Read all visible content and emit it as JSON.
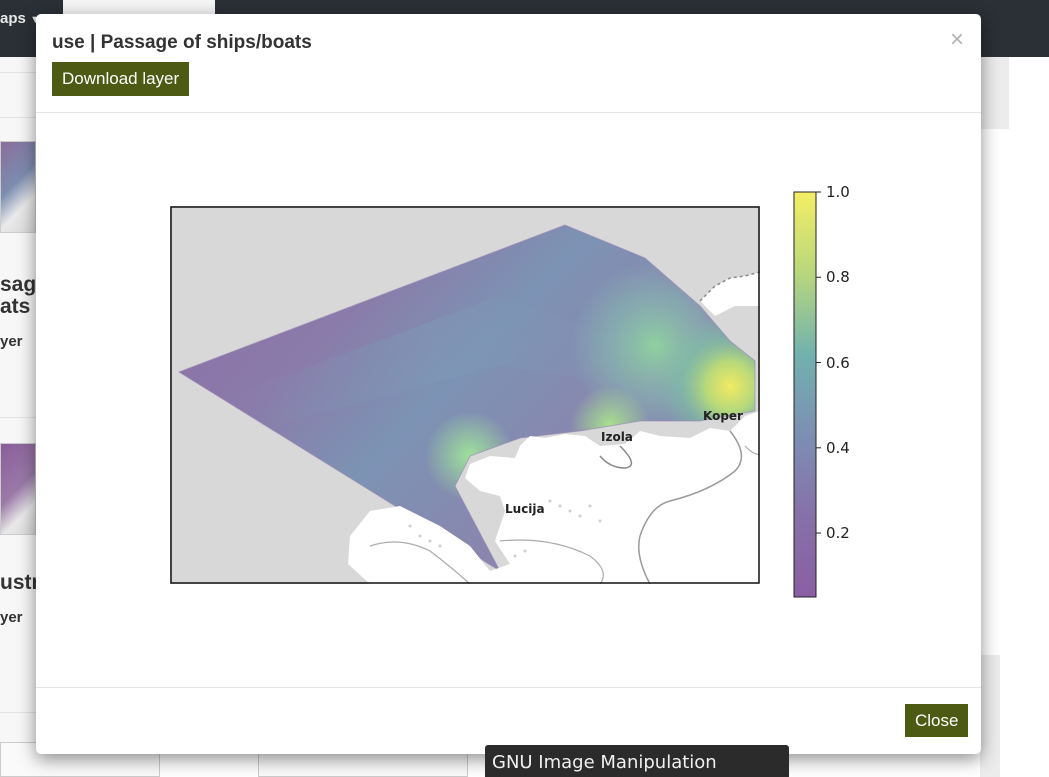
{
  "background": {
    "nav_maps_label": "aps",
    "card1_title_line1": "sage",
    "card1_title_line2": "ats",
    "card1_sub": "yer",
    "card2_title": "ustr",
    "card2_sub": "yer"
  },
  "modal": {
    "title": "use | Passage of ships/boats",
    "download_label": "Download layer",
    "close_x": "×",
    "close_label": "Close"
  },
  "map": {
    "places": {
      "koper": "Koper",
      "izola": "Izola",
      "lucija": "Lucija"
    },
    "colorbar": {
      "ticks": [
        "1.0",
        "0.8",
        "0.6",
        "0.4",
        "0.2"
      ],
      "tick_values": [
        1.0,
        0.8,
        0.6,
        0.4,
        0.2
      ],
      "min": 0.05,
      "max": 1.0,
      "colormap": "viridis"
    },
    "colors": {
      "land": "#d8d8d8",
      "coast_fill": "#ffffff",
      "low": "#8e6aa6",
      "mid": "#7c96b6",
      "high": "#f2ea62"
    }
  },
  "tooltip": {
    "text": "GNU Image Manipulation Program"
  }
}
